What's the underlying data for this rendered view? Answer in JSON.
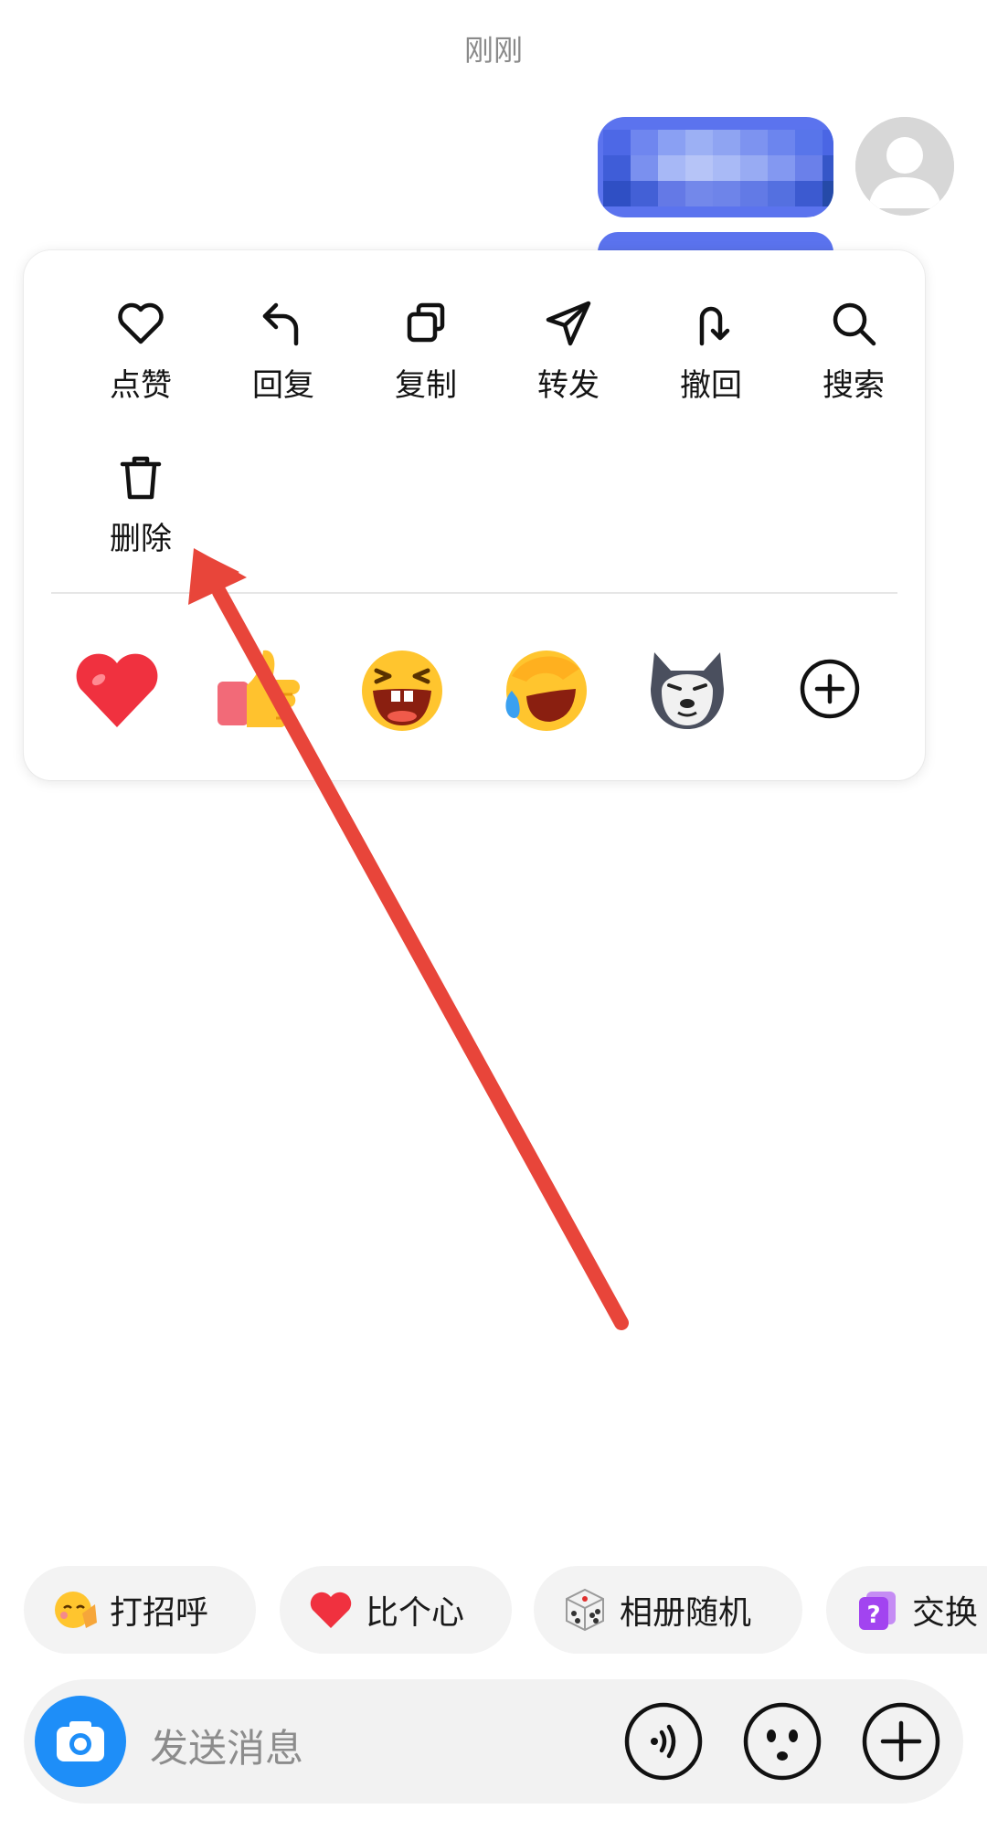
{
  "chat": {
    "timestamp": "刚刚"
  },
  "menu": {
    "actions": [
      {
        "label": "点赞",
        "icon": "heart-icon"
      },
      {
        "label": "回复",
        "icon": "reply-arrow-icon"
      },
      {
        "label": "复制",
        "icon": "copy-icon"
      },
      {
        "label": "转发",
        "icon": "paper-plane-icon"
      },
      {
        "label": "撤回",
        "icon": "undo-u-turn-icon"
      },
      {
        "label": "搜索",
        "icon": "search-icon"
      },
      {
        "label": "删除",
        "icon": "trash-icon"
      }
    ],
    "reactions": [
      "red-heart-emoji",
      "thumbs-up-emoji",
      "laughing-face-emoji",
      "rofl-face-emoji",
      "husky-dog-emoji",
      "add-reaction-icon"
    ]
  },
  "quick_replies": [
    {
      "label": "打招呼",
      "icon": "waving-face-emoji"
    },
    {
      "label": "比个心",
      "icon": "red-heart-emoji"
    },
    {
      "label": "相册随机",
      "icon": "dice-icon"
    },
    {
      "label": "交换",
      "icon": "question-card-icon"
    }
  ],
  "composer": {
    "placeholder": "发送消息",
    "icons": [
      "camera-icon",
      "voice-icon",
      "emoji-face-icon",
      "plus-icon"
    ]
  },
  "colors": {
    "bubble": "#5b73ee",
    "camera": "#1e8ef8",
    "annotation_arrow": "#e8453a"
  }
}
